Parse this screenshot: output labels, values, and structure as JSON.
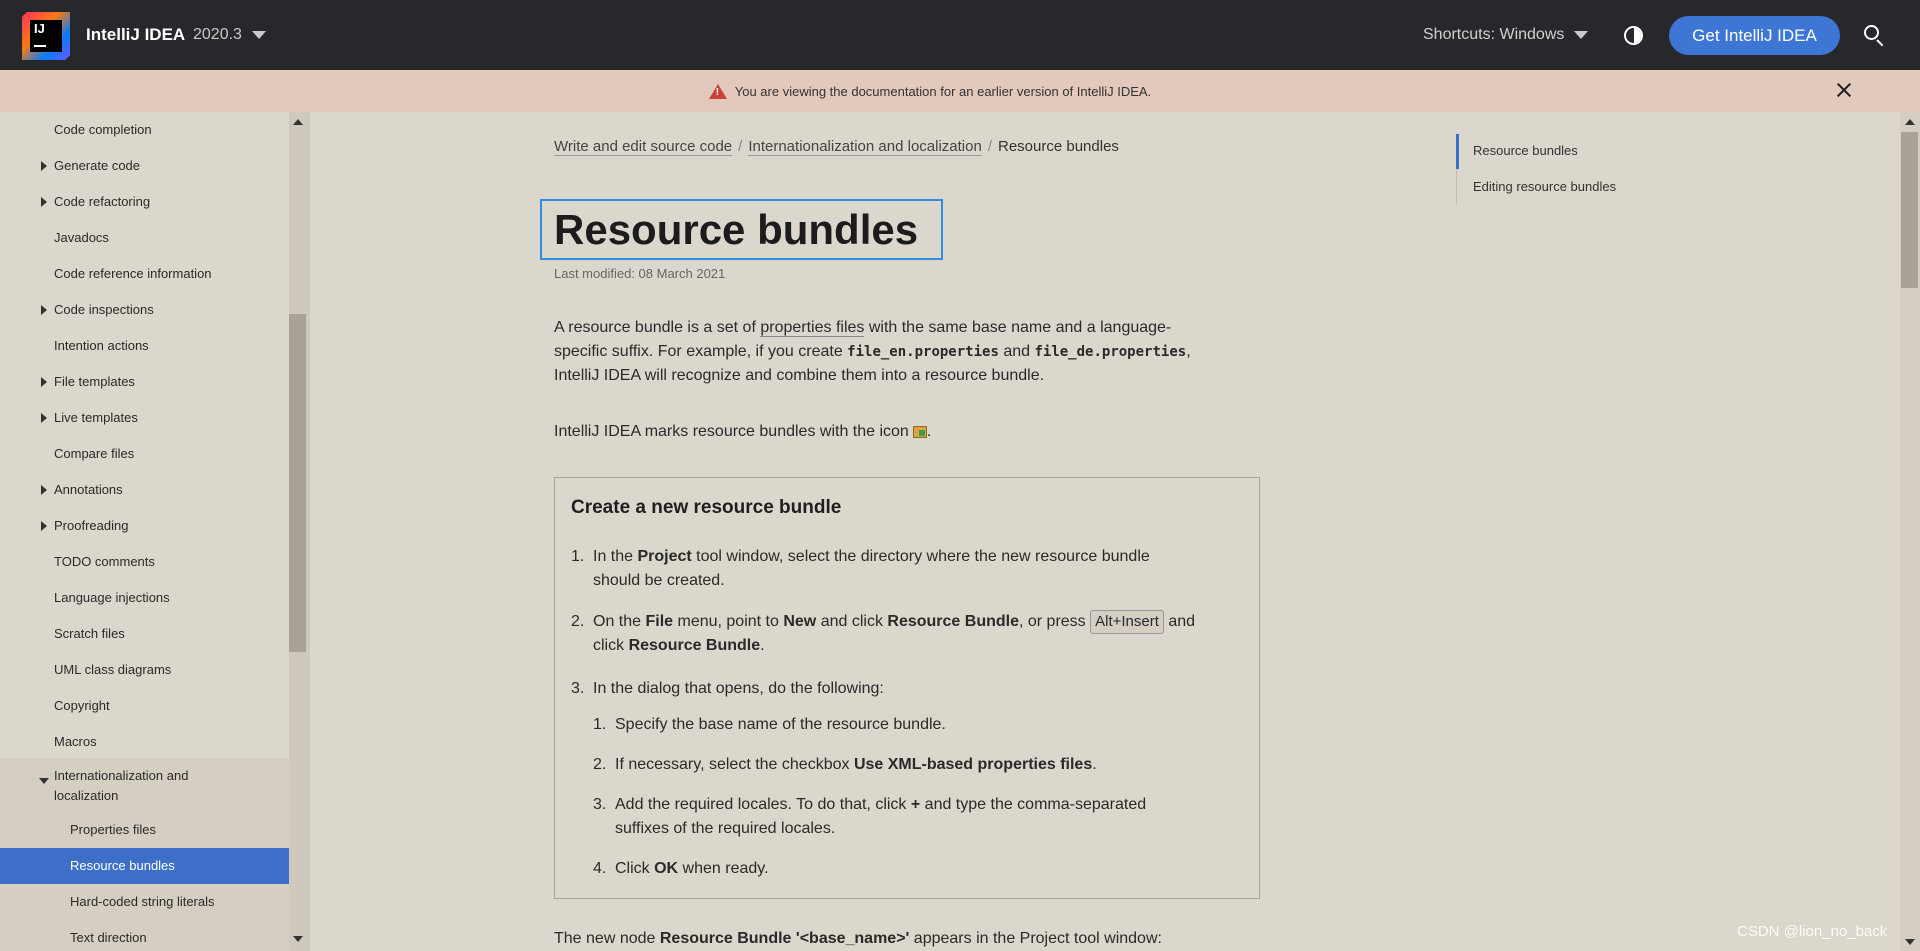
{
  "header": {
    "logo_text": "IJ",
    "product_name": "IntelliJ IDEA",
    "version": "2020.3",
    "shortcuts_label": "Shortcuts: Windows",
    "get_button": "Get IntelliJ IDEA",
    "colors": {
      "background": "#27282c",
      "button": "#3d76d4"
    }
  },
  "banner": {
    "text": "You are viewing the documentation for an earlier version of IntelliJ IDEA."
  },
  "sidebar": {
    "items": [
      {
        "label": "Code completion",
        "arrow": "none"
      },
      {
        "label": "Generate code",
        "arrow": "right"
      },
      {
        "label": "Code refactoring",
        "arrow": "right"
      },
      {
        "label": "Javadocs",
        "arrow": "none"
      },
      {
        "label": "Code reference information",
        "arrow": "none"
      },
      {
        "label": "Code inspections",
        "arrow": "right"
      },
      {
        "label": "Intention actions",
        "arrow": "none"
      },
      {
        "label": "File templates",
        "arrow": "right"
      },
      {
        "label": "Live templates",
        "arrow": "right"
      },
      {
        "label": "Compare files",
        "arrow": "none"
      },
      {
        "label": "Annotations",
        "arrow": "right"
      },
      {
        "label": "Proofreading",
        "arrow": "right"
      },
      {
        "label": "TODO comments",
        "arrow": "none"
      },
      {
        "label": "Language injections",
        "arrow": "none"
      },
      {
        "label": "Scratch files",
        "arrow": "none"
      },
      {
        "label": "UML class diagrams",
        "arrow": "none"
      },
      {
        "label": "Copyright",
        "arrow": "none"
      },
      {
        "label": "Macros",
        "arrow": "none"
      }
    ],
    "group": {
      "label_line1": "Internationalization and",
      "label_line2": "localization",
      "children": [
        {
          "label": "Properties files"
        },
        {
          "label": "Resource bundles",
          "selected": true
        },
        {
          "label": "Hard-coded string literals"
        },
        {
          "label": "Text direction"
        }
      ]
    }
  },
  "breadcrumb": {
    "items": [
      "Write and edit source code",
      "Internationalization and localization"
    ],
    "current": "Resource bundles",
    "separator": "/"
  },
  "article": {
    "title": "Resource bundles",
    "modified": "Last modified: 08 March 2021",
    "intro_part1": "A resource bundle is a set of ",
    "intro_link": "properties files",
    "intro_part2": " with the same base name and a language-",
    "intro_part3": "specific suffix. For example, if you create ",
    "intro_code1": "file_en.properties",
    "intro_and": " and ",
    "intro_code2": "file_de.properties",
    "intro_comma": ",",
    "intro_part4": "IntelliJ IDEA will recognize and combine them into a resource bundle.",
    "marks_text": "IntelliJ IDEA marks resource bundles with the icon",
    "marks_end": ".",
    "procedure": {
      "title": "Create a new resource bundle",
      "step1_num": "1.",
      "step1_a": "In the ",
      "step1_b": "Project",
      "step1_c": " tool window, select the directory where the new resource bundle",
      "step1_d": "should be created.",
      "step2_num": "2.",
      "step2_a": "On the ",
      "step2_b": "File",
      "step2_c": " menu, point to ",
      "step2_d": "New",
      "step2_e": " and click ",
      "step2_f": "Resource Bundle",
      "step2_g": ", or press ",
      "step2_kbd": "Alt+Insert",
      "step2_h": " and",
      "step2_i": "click ",
      "step2_j": "Resource Bundle",
      "step2_k": ".",
      "step3_num": "3.",
      "step3_text": "In the dialog that opens, do the following:",
      "sub1_num": "1.",
      "sub1_text": "Specify the base name of the resource bundle.",
      "sub2_num": "2.",
      "sub2_a": "If necessary, select the checkbox ",
      "sub2_b": "Use XML-based properties files",
      "sub2_c": ".",
      "sub3_num": "3.",
      "sub3_a": "Add the required locales. To do that, click ",
      "sub3_plus": "+",
      "sub3_b": " and type the comma-separated",
      "sub3_c": "suffixes of the required locales.",
      "sub4_num": "4.",
      "sub4_a": "Click ",
      "sub4_b": "OK",
      "sub4_c": " when ready."
    },
    "bottom_a": "The new node ",
    "bottom_b": "Resource Bundle '<base_name>'",
    "bottom_c": " appears in the Project tool window:"
  },
  "toc": {
    "items": [
      "Resource bundles",
      "Editing resource bundles"
    ]
  },
  "watermark": "CSDN @lion_no_back"
}
